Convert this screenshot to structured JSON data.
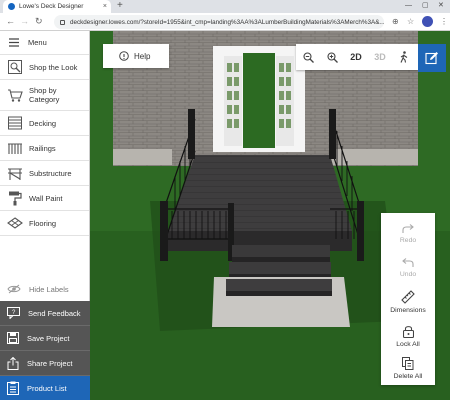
{
  "browser": {
    "tab_title": "Lowe's Deck Designer",
    "tab_close": "×",
    "new_tab": "+",
    "url": "deckdesigner.lowes.com/?storeId=1955&int_cmp=landing%3AA%3ALumberBuildingMaterials%3AMerch%3A&..."
  },
  "sidebar": {
    "menu_label": "Menu",
    "items": [
      {
        "label": "Shop the Look",
        "icon": "shop-look-icon"
      },
      {
        "label": "Shop by Category",
        "icon": "shop-category-icon"
      },
      {
        "label": "Decking",
        "icon": "decking-icon"
      },
      {
        "label": "Railings",
        "icon": "railings-icon"
      },
      {
        "label": "Substructure",
        "icon": "substructure-icon"
      },
      {
        "label": "Wall Paint",
        "icon": "paint-roller-icon"
      },
      {
        "label": "Flooring",
        "icon": "flooring-icon"
      }
    ],
    "hide_labels": "Hide Labels",
    "actions": [
      {
        "label": "Send Feedback",
        "icon": "feedback-icon"
      },
      {
        "label": "Save Project",
        "icon": "save-icon"
      },
      {
        "label": "Share Project",
        "icon": "share-icon"
      },
      {
        "label": "Product List",
        "icon": "product-list-icon"
      }
    ]
  },
  "toolbar": {
    "help_label": "Help",
    "view_2d": "2D",
    "view_3d": "3D"
  },
  "tools": {
    "redo": "Redo",
    "undo": "Undo",
    "dimensions": "Dimensions",
    "lock_all": "Lock All",
    "delete_all": "Delete All"
  },
  "colors": {
    "accent_blue": "#1e66b7",
    "dark_button": "#555555",
    "grass": "#2f6a25",
    "brick": "#8a8580"
  }
}
